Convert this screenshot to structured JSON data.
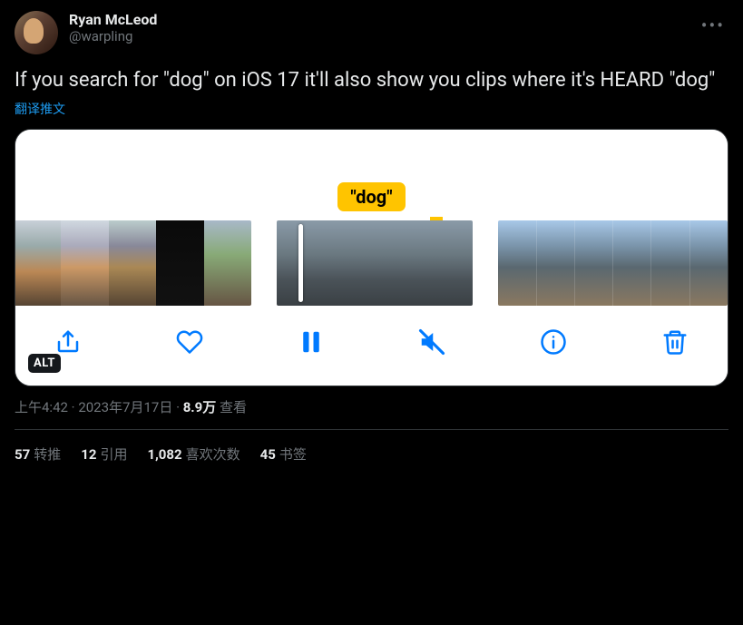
{
  "user": {
    "display_name": "Ryan McLeod",
    "handle": "@warpling"
  },
  "tweet_text": "If you search for \"dog\" on iOS 17 it'll also show you clips where it's HEARD \"dog\"",
  "translate_label": "翻译推文",
  "media": {
    "search_term_label": "\"dog\"",
    "alt_badge": "ALT"
  },
  "meta": {
    "time": "上午4:42",
    "date": "2023年7月17日",
    "views_count": "8.9万",
    "views_label": "查看"
  },
  "stats": {
    "retweets_count": "57",
    "retweets_label": "转推",
    "quotes_count": "12",
    "quotes_label": "引用",
    "likes_count": "1,082",
    "likes_label": "喜欢次数",
    "bookmarks_count": "45",
    "bookmarks_label": "书签"
  }
}
